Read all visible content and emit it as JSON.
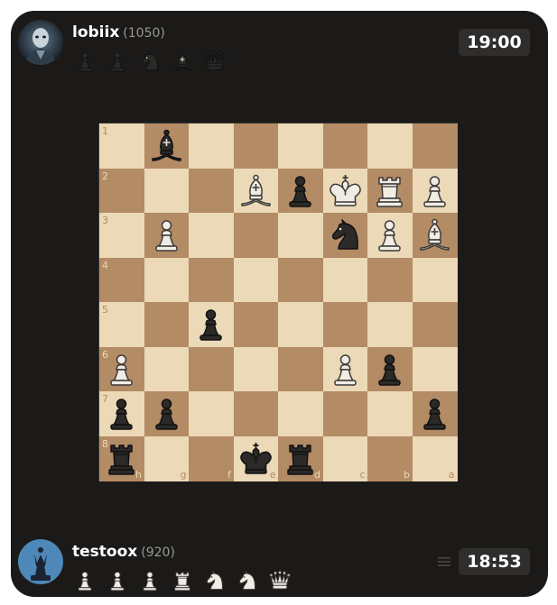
{
  "top_player": {
    "name": "lobiix",
    "rating": "(1050)",
    "clock": "19:00",
    "captured": [
      {
        "type": "pawn",
        "color": "black"
      },
      {
        "type": "pawn",
        "color": "black"
      },
      {
        "type": "knight",
        "color": "black"
      },
      {
        "type": "bishop",
        "color": "black"
      },
      {
        "type": "queen",
        "color": "black"
      }
    ]
  },
  "bottom_player": {
    "name": "testoox",
    "rating": "(920)",
    "clock": "18:53",
    "captured": [
      {
        "type": "pawn",
        "color": "white"
      },
      {
        "type": "pawn",
        "color": "white"
      },
      {
        "type": "pawn",
        "color": "white"
      },
      {
        "type": "rook",
        "color": "white"
      },
      {
        "type": "knight",
        "color": "white"
      },
      {
        "type": "knight",
        "color": "white"
      },
      {
        "type": "queen",
        "color": "white"
      }
    ]
  },
  "board": {
    "ranks": [
      "1",
      "2",
      "3",
      "4",
      "5",
      "6",
      "7",
      "8"
    ],
    "files": [
      "h",
      "g",
      "f",
      "e",
      "d",
      "c",
      "b",
      "a"
    ],
    "light_color": "#ecd9b7",
    "dark_color": "#b38b65",
    "pieces": [
      {
        "row": 0,
        "col": 1,
        "type": "bishop",
        "color": "black"
      },
      {
        "row": 1,
        "col": 3,
        "type": "bishop",
        "color": "white"
      },
      {
        "row": 1,
        "col": 4,
        "type": "pawn",
        "color": "black"
      },
      {
        "row": 1,
        "col": 5,
        "type": "king",
        "color": "white"
      },
      {
        "row": 1,
        "col": 6,
        "type": "rook",
        "color": "white"
      },
      {
        "row": 1,
        "col": 7,
        "type": "pawn",
        "color": "white"
      },
      {
        "row": 2,
        "col": 1,
        "type": "pawn",
        "color": "white"
      },
      {
        "row": 2,
        "col": 5,
        "type": "knight",
        "color": "black"
      },
      {
        "row": 2,
        "col": 6,
        "type": "pawn",
        "color": "white"
      },
      {
        "row": 2,
        "col": 7,
        "type": "bishop",
        "color": "white"
      },
      {
        "row": 4,
        "col": 2,
        "type": "pawn",
        "color": "black"
      },
      {
        "row": 5,
        "col": 0,
        "type": "pawn",
        "color": "white"
      },
      {
        "row": 5,
        "col": 5,
        "type": "pawn",
        "color": "white"
      },
      {
        "row": 5,
        "col": 6,
        "type": "pawn",
        "color": "black"
      },
      {
        "row": 6,
        "col": 0,
        "type": "pawn",
        "color": "black"
      },
      {
        "row": 6,
        "col": 1,
        "type": "pawn",
        "color": "black"
      },
      {
        "row": 6,
        "col": 7,
        "type": "pawn",
        "color": "black"
      },
      {
        "row": 7,
        "col": 0,
        "type": "rook",
        "color": "black"
      },
      {
        "row": 7,
        "col": 3,
        "type": "king",
        "color": "black"
      },
      {
        "row": 7,
        "col": 4,
        "type": "rook",
        "color": "black"
      }
    ]
  },
  "icons": {
    "top_avatar": "robot-avatar-icon",
    "bottom_avatar": "chess-queen-avatar-icon",
    "menu": "hamburger-menu-icon"
  }
}
